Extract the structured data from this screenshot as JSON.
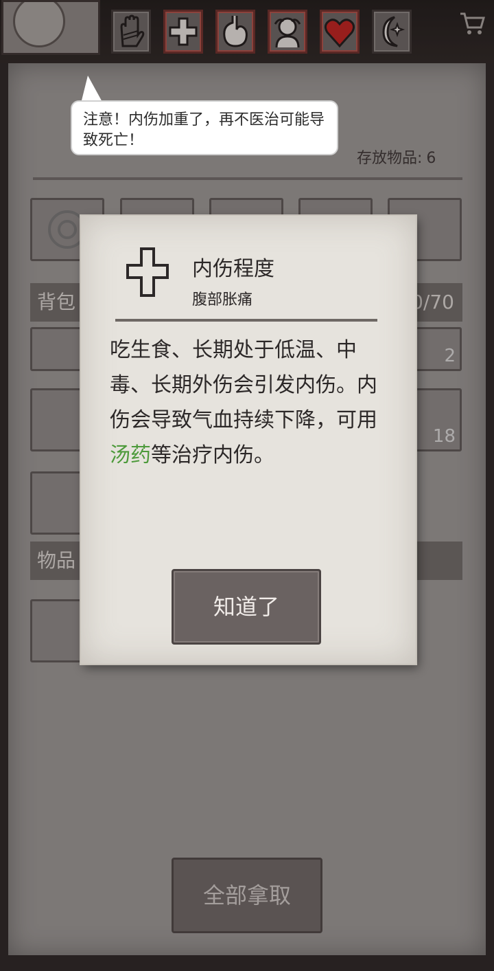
{
  "topbar": {
    "stats": [
      {
        "icon": "bandaged-hand-icon",
        "color": "#6b6664"
      },
      {
        "icon": "medical-cross-icon",
        "color": "#6c2e2a"
      },
      {
        "icon": "stomach-icon",
        "color": "#6c2e2a"
      },
      {
        "icon": "head-ache-icon",
        "color": "#6c2e2a"
      },
      {
        "icon": "heart-icon",
        "color": "#c0201e"
      },
      {
        "icon": "moon-star-icon",
        "color": "#6b6664"
      }
    ],
    "cart_icon": "shopping-cart-icon"
  },
  "storage": {
    "label": "存放物品:",
    "count": "6"
  },
  "backpack": {
    "label": "背包",
    "capacity": "0/70"
  },
  "items_label": "物品",
  "item_counts": {
    "slot_a": "2",
    "slot_b": "18"
  },
  "speech_bubble": {
    "text": "注意！内伤加重了，再不医治可能导致死亡！"
  },
  "dialog": {
    "title": "内伤程度",
    "subtitle": "腹部胀痛",
    "body_before": "吃生食、长期处于低温、中毒、长期外伤会引发内伤。内伤会导致气血持续下降，可用",
    "body_highlight": "汤药",
    "body_after": "等治疗内伤。",
    "confirm_label": "知道了",
    "highlight_color": "#4d9a3b"
  },
  "take_all_label": "全部拿取"
}
